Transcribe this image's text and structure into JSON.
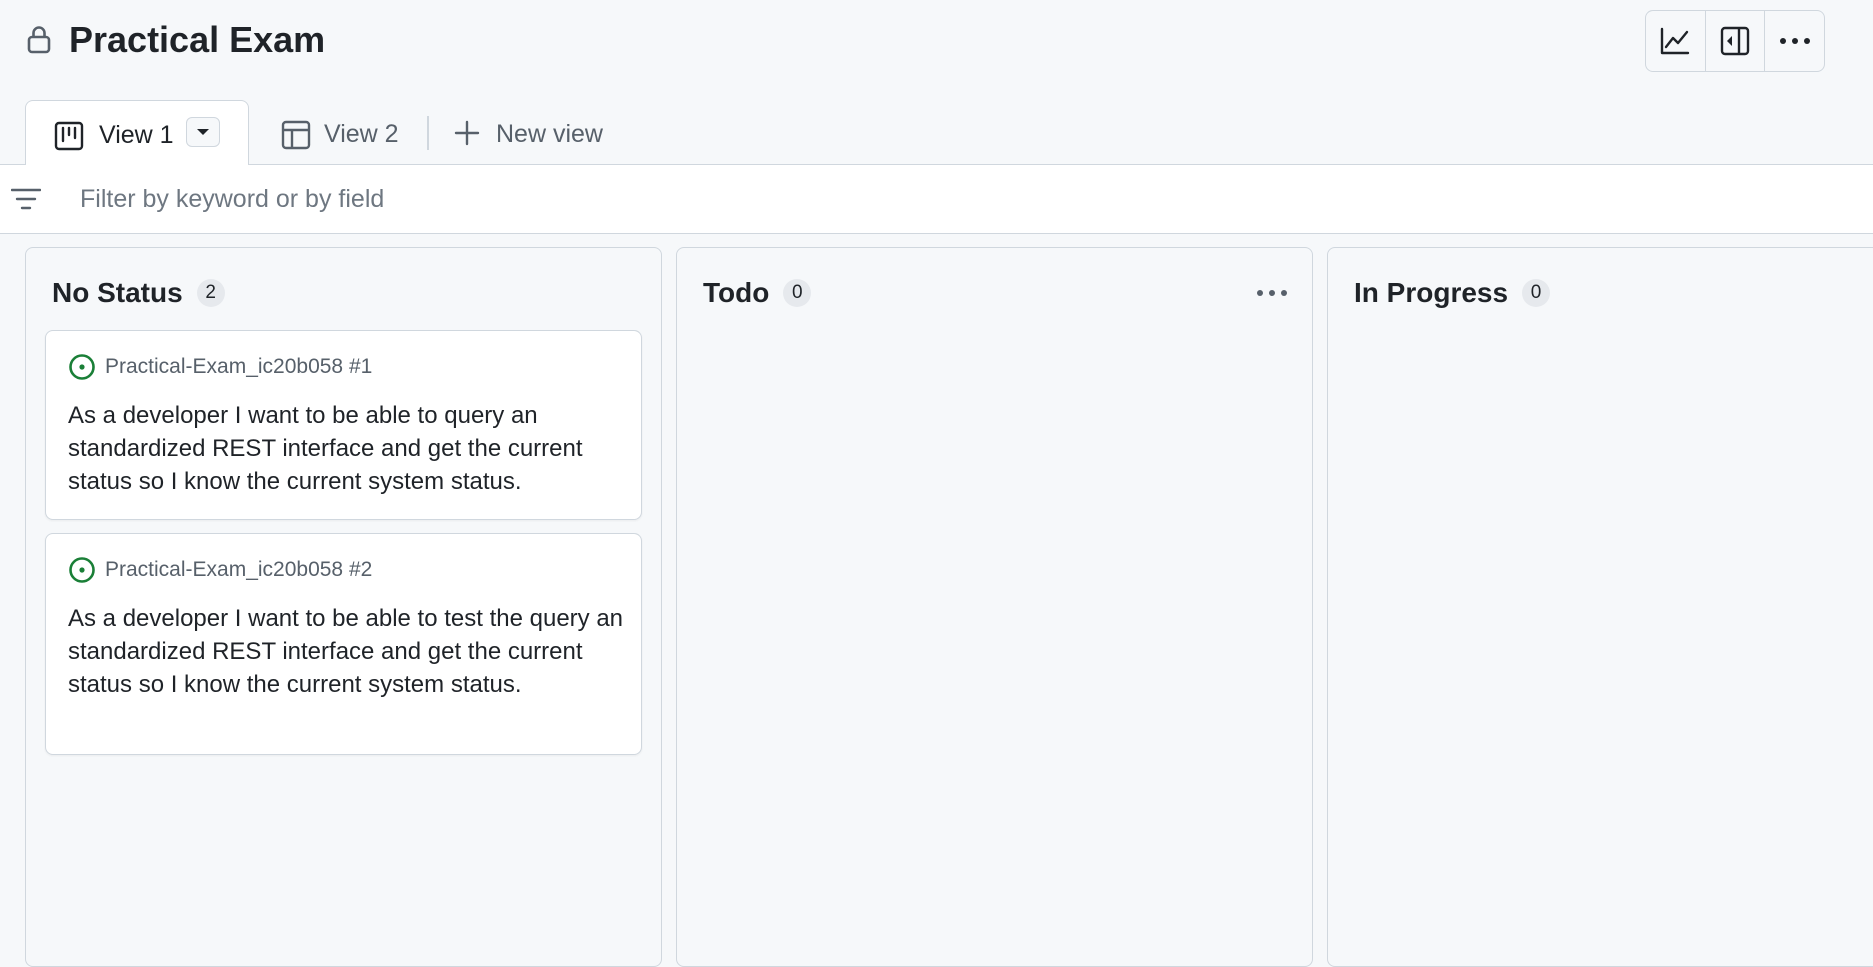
{
  "header": {
    "title": "Practical Exam",
    "lock_icon": "lock-icon",
    "toolbar": [
      {
        "name": "insights-button",
        "icon": "graph-icon"
      },
      {
        "name": "side-panel-button",
        "icon": "sidebar-collapse-icon"
      },
      {
        "name": "more-options-button",
        "icon": "kebab-horizontal-icon"
      }
    ]
  },
  "tabs": {
    "view1": {
      "label": "View 1",
      "icon": "board-icon"
    },
    "view2": {
      "label": "View 2",
      "icon": "table-icon"
    },
    "new_view": {
      "label": "New view",
      "icon": "plus-icon"
    }
  },
  "filter": {
    "placeholder": "Filter by keyword or by field",
    "value": ""
  },
  "columns": [
    {
      "title": "No Status",
      "count": "2",
      "cards": [
        {
          "repo": "Practical-Exam_ic20b058 #1",
          "text": "As a developer I want to be able to query an standardized REST interface and get the current status so I know the current system status."
        },
        {
          "repo": "Practical-Exam_ic20b058 #2",
          "text": "As a developer I want to be able to test the query an standardized REST interface and get the current status so I know the current system status."
        }
      ]
    },
    {
      "title": "Todo",
      "count": "0",
      "cards": []
    },
    {
      "title": "In Progress",
      "count": "0",
      "cards": []
    }
  ],
  "colors": {
    "background": "#f6f8fa",
    "border": "#d0d7de",
    "text": "#1f2328",
    "muted": "#57606a",
    "open_issue": "#1a7f37"
  }
}
